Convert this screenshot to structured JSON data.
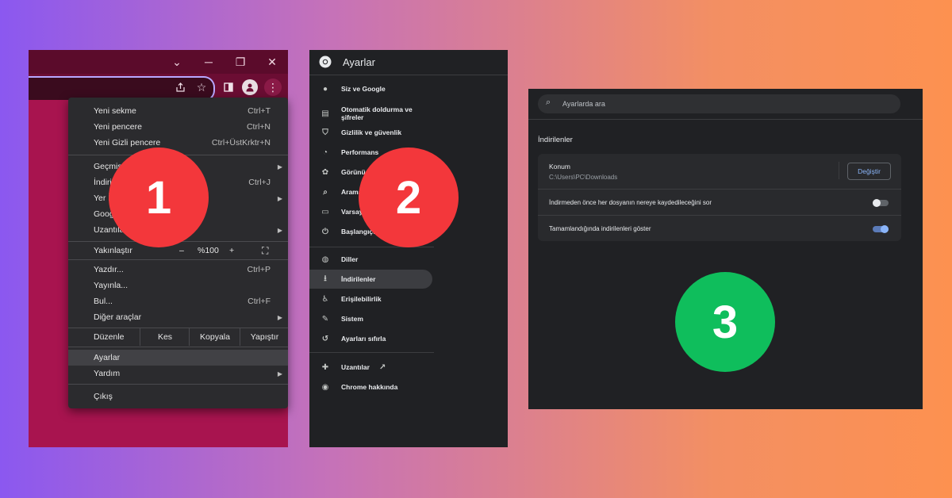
{
  "colors": {
    "badge_red": "#f3373b",
    "badge_green": "#0fbe5c",
    "chrome_crimson": "#a8144f",
    "dark_bg": "#202124",
    "accent_blue": "#8ab4f8"
  },
  "badges": [
    "1",
    "2",
    "3"
  ],
  "panel1": {
    "window_buttons": [
      "chevron-down-icon",
      "minimize-icon",
      "restore-icon",
      "close-icon"
    ],
    "menu": {
      "group1": [
        {
          "label": "Yeni sekme",
          "shortcut": "Ctrl+T"
        },
        {
          "label": "Yeni pencere",
          "shortcut": "Ctrl+N"
        },
        {
          "label": "Yeni Gizli pencere",
          "shortcut": "Ctrl+ÜstKrktr+N"
        }
      ],
      "group2": [
        {
          "label": "Geçmiş",
          "shortcut": ""
        },
        {
          "label": "İndirilenler",
          "shortcut": "Ctrl+J"
        },
        {
          "label": "Yer İşaretleri",
          "shortcut": ""
        },
        {
          "label": "Google",
          "shortcut": ""
        },
        {
          "label": "Uzantılar",
          "shortcut": ""
        }
      ],
      "zoom": {
        "label": "Yakınlaştır",
        "minus": "–",
        "value": "%100",
        "plus": "+"
      },
      "group3": [
        {
          "label": "Yazdır...",
          "shortcut": "Ctrl+P"
        },
        {
          "label": "Yayınla...",
          "shortcut": ""
        },
        {
          "label": "Bul...",
          "shortcut": "Ctrl+F"
        },
        {
          "label": "Diğer araçlar",
          "shortcut": ""
        }
      ],
      "edit": {
        "label": "Düzenle",
        "cut": "Kes",
        "copy": "Kopyala",
        "paste": "Yapıştır"
      },
      "settings": "Ayarlar",
      "help": "Yardım",
      "exit": "Çıkış"
    }
  },
  "panel2": {
    "title": "Ayarlar",
    "items": [
      {
        "label": "Siz ve Google",
        "icon": "person-icon"
      },
      {
        "label": "Otomatik doldurma ve şifreler",
        "icon": "clipboard-icon"
      },
      {
        "label": "Gizlilik ve güvenlik",
        "icon": "shield-icon"
      },
      {
        "label": "Performans",
        "icon": "gauge-icon"
      },
      {
        "label": "Görünüş",
        "icon": "palette-icon"
      },
      {
        "label": "Arama",
        "icon": "search-icon"
      },
      {
        "label": "Varsayılan",
        "icon": "browser-icon"
      },
      {
        "label": "Başlangıçta",
        "icon": "power-icon"
      },
      {
        "label": "Diller",
        "icon": "globe-icon"
      },
      {
        "label": "İndirilenler",
        "icon": "download-icon"
      },
      {
        "label": "Erişilebilirlik",
        "icon": "accessibility-icon"
      },
      {
        "label": "Sistem",
        "icon": "wrench-icon"
      },
      {
        "label": "Ayarları sıfırla",
        "icon": "reset-icon"
      },
      {
        "label": "Uzantılar",
        "icon": "puzzle-icon"
      },
      {
        "label": "Chrome hakkında",
        "icon": "chrome-icon"
      }
    ]
  },
  "panel3": {
    "search_placeholder": "Ayarlarda ara",
    "section_title": "İndirilenler",
    "location_label": "Konum",
    "location_path": "C:\\Users\\PC\\Downloads",
    "change_button": "Değiştir",
    "ask_label": "İndirmeden önce her dosyanın nereye kaydedileceğini sor",
    "ask_enabled": false,
    "show_label": "Tamamlandığında indirilenleri göster",
    "show_enabled": true
  }
}
